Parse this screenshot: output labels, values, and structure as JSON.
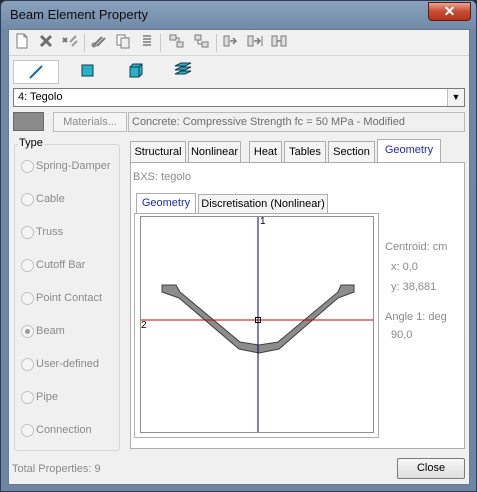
{
  "window": {
    "title": "Beam Element Property"
  },
  "toolbar": {
    "icons": [
      "new-icon",
      "delete-icon",
      "clean-icon",
      "cut-icon",
      "copy-icon",
      "paste-icon",
      "import-icon",
      "export-icon",
      "send-icon",
      "send-all-icon",
      "transfer-icon"
    ]
  },
  "type_toolbar": {
    "icons": [
      "line-icon",
      "square-icon",
      "cube-icon",
      "stack-icon"
    ]
  },
  "property_select": {
    "value": "4: Tegolo"
  },
  "material": {
    "button_label": "Materials...",
    "description": "Concrete: Compressive Strength fc = 50 MPa - Modified",
    "swatch_color": "#8a8a8a"
  },
  "type_group": {
    "legend": "Type",
    "options": [
      "Spring-Damper",
      "Cable",
      "Truss",
      "Cutoff Bar",
      "Point Contact",
      "Beam",
      "User-defined",
      "Pipe",
      "Connection"
    ],
    "selected": "Beam"
  },
  "tabs": [
    "Structural",
    "Nonlinear",
    "Heat",
    "Tables",
    "Section",
    "Geometry"
  ],
  "active_tab": "Geometry",
  "section": {
    "name": "BXS: tegolo",
    "subtabs": [
      "Geometry",
      "Discretisation (Nonlinear)"
    ],
    "active_subtab": "Geometry",
    "axis1_label": "1",
    "axis2_label": "2",
    "centroid": {
      "title": "Centroid: cm",
      "x": "x: 0,0",
      "y": "y: 38,681"
    },
    "angle": {
      "title": "Angle 1: deg",
      "value": "90,0"
    }
  },
  "footer": {
    "total": "Total Properties: 9",
    "close_label": "Close"
  },
  "colors": {
    "accent_tab": "#1f2bb0",
    "section_fill": "#8c8c8c",
    "axis2": "#c80000",
    "axis1": "#000080"
  }
}
